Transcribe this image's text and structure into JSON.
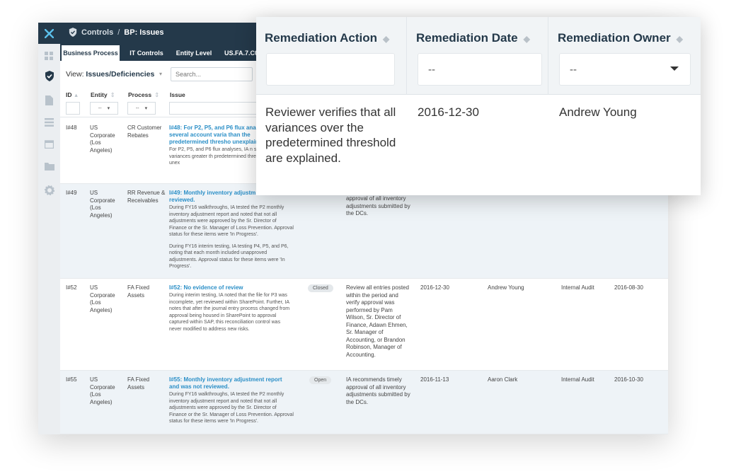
{
  "app": {
    "breadcrumb_root": "Controls",
    "breadcrumb_sep": "/",
    "breadcrumb_current": "BP: Issues"
  },
  "tabs": [
    "Business Process",
    "IT Controls",
    "Entity Level",
    "US.FA.7.C0"
  ],
  "view": {
    "label": "View:",
    "value": "Issues/Deficiencies",
    "search_placeholder": "Search..."
  },
  "columns": {
    "id": "ID",
    "entity": "Entity",
    "process": "Process",
    "issue": "Issue",
    "filter_placeholder": "--"
  },
  "rows": [
    {
      "id": "I#48",
      "entity": "US Corporate (Los Angeles)",
      "process": "CR Customer Rebates",
      "title": "I#48: For P2, P5, and P6 flux ana noted that several account varia than the predetermined thresho unexplained.",
      "desc": "For P2, P5, and P6 flux analyses, IA n several account variances greater th predetermined threshold were unex",
      "status": "",
      "action": "",
      "date": "",
      "owner": "",
      "group": "",
      "due": ""
    },
    {
      "id": "I#49",
      "entity": "US Corporate (Los Angeles)",
      "process": "RR Revenue & Receivables",
      "title": "I#49: Monthly inventory adjustm and was not reviewed.",
      "desc": "During FY16 walkthroughs, IA tested the P2 monthly inventory adjustment report and noted that not all adjustments were approved by the Sr. Director of Finance or the Sr. Manager of Loss Prevention. Approval status for these items were 'In Progress'.",
      "desc2": "During FY16 interim testing, IA testing P4, P5, and P6, noting that each month included unapproved adjustments. Approval status for these items were 'In Progress'.",
      "status": "",
      "action": "approval of all inventory adjustments submitted by the DCs.",
      "date": "",
      "owner": "",
      "group": "",
      "due": ""
    },
    {
      "id": "I#52",
      "entity": "US Corporate (Los Angeles)",
      "process": "FA Fixed Assets",
      "title": "I#52: No evidence of review",
      "desc": "During interim testing, IA noted that the file for P3 was incomplete, yet reviewed within SharePoint. Further, IA notes that after the journal entry process changed from approval being housed in SharePoint to approval captured within SAP, this reconciliation control was never modified to address new risks.",
      "status": "Closed",
      "action": "Review all entries posted within the period and verify approval was performed by Pam Wilson, Sr. Director of Finance, Adawn Ehmen, Sr. Manager of Accounting, or Brandon Robinson, Manager of Accounting.",
      "date": "2016-12-30",
      "owner": "Andrew Young",
      "group": "Internal Audit",
      "due": "2016-08-30"
    },
    {
      "id": "I#55",
      "entity": "US Corporate (Los Angeles)",
      "process": "FA Fixed Assets",
      "title": "I#55: Monthly inventory adjustment report and was not reviewed.",
      "desc": "During FY16 walkthroughs, IA tested the P2 monthly inventory adjustment report and noted that not all adjustments were approved by the Sr. Director of Finance or the Sr. Manager of Loss Prevention. Approval status for these items were 'In Progress'.",
      "status": "Open",
      "action": "IA recommends timely approval of all inventory adjustments submitted by the DCs.",
      "date": "2016-11-13",
      "owner": "Aaron Clark",
      "group": "Internal Audit",
      "due": "2016-10-30"
    }
  ],
  "overlay": {
    "col_action": "Remediation Action",
    "col_date": "Remediation Date",
    "col_owner": "Remediation Owner",
    "date_filter": "--",
    "owner_filter": "--",
    "action_value": "Reviewer verifies that all variances over the predetermined threshold are explained.",
    "date_value": "2016-12-30",
    "owner_value": "Andrew Young"
  },
  "icons": {
    "brand": "x-logo-icon",
    "colors": {
      "navy": "#24394a",
      "link": "#2b8fc7",
      "alt_row": "#eef3f7"
    }
  }
}
